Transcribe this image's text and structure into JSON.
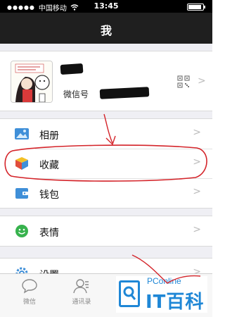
{
  "status_bar": {
    "carrier": "中国移动",
    "time": "13:45"
  },
  "navbar": {
    "title": "我"
  },
  "profile": {
    "wechat_id_label": "微信号"
  },
  "menu_groups": [
    [
      {
        "key": "album",
        "label": "相册",
        "icon": "photo-icon"
      },
      {
        "key": "favorites",
        "label": "收藏",
        "icon": "cube-icon"
      },
      {
        "key": "wallet",
        "label": "钱包",
        "icon": "wallet-icon"
      }
    ],
    [
      {
        "key": "stickers",
        "label": "表情",
        "icon": "smiley-icon"
      }
    ],
    [
      {
        "key": "settings",
        "label": "设置",
        "icon": "gear-icon"
      }
    ]
  ],
  "tab_bar": {
    "chats": "微信",
    "contacts": "通讯录"
  },
  "watermark": {
    "top": "PConline",
    "main": "IT百科"
  },
  "colors": {
    "annotation": "#d4242a",
    "brand_blue": "#1f87d6",
    "nav_bg": "#1f1f1f"
  }
}
